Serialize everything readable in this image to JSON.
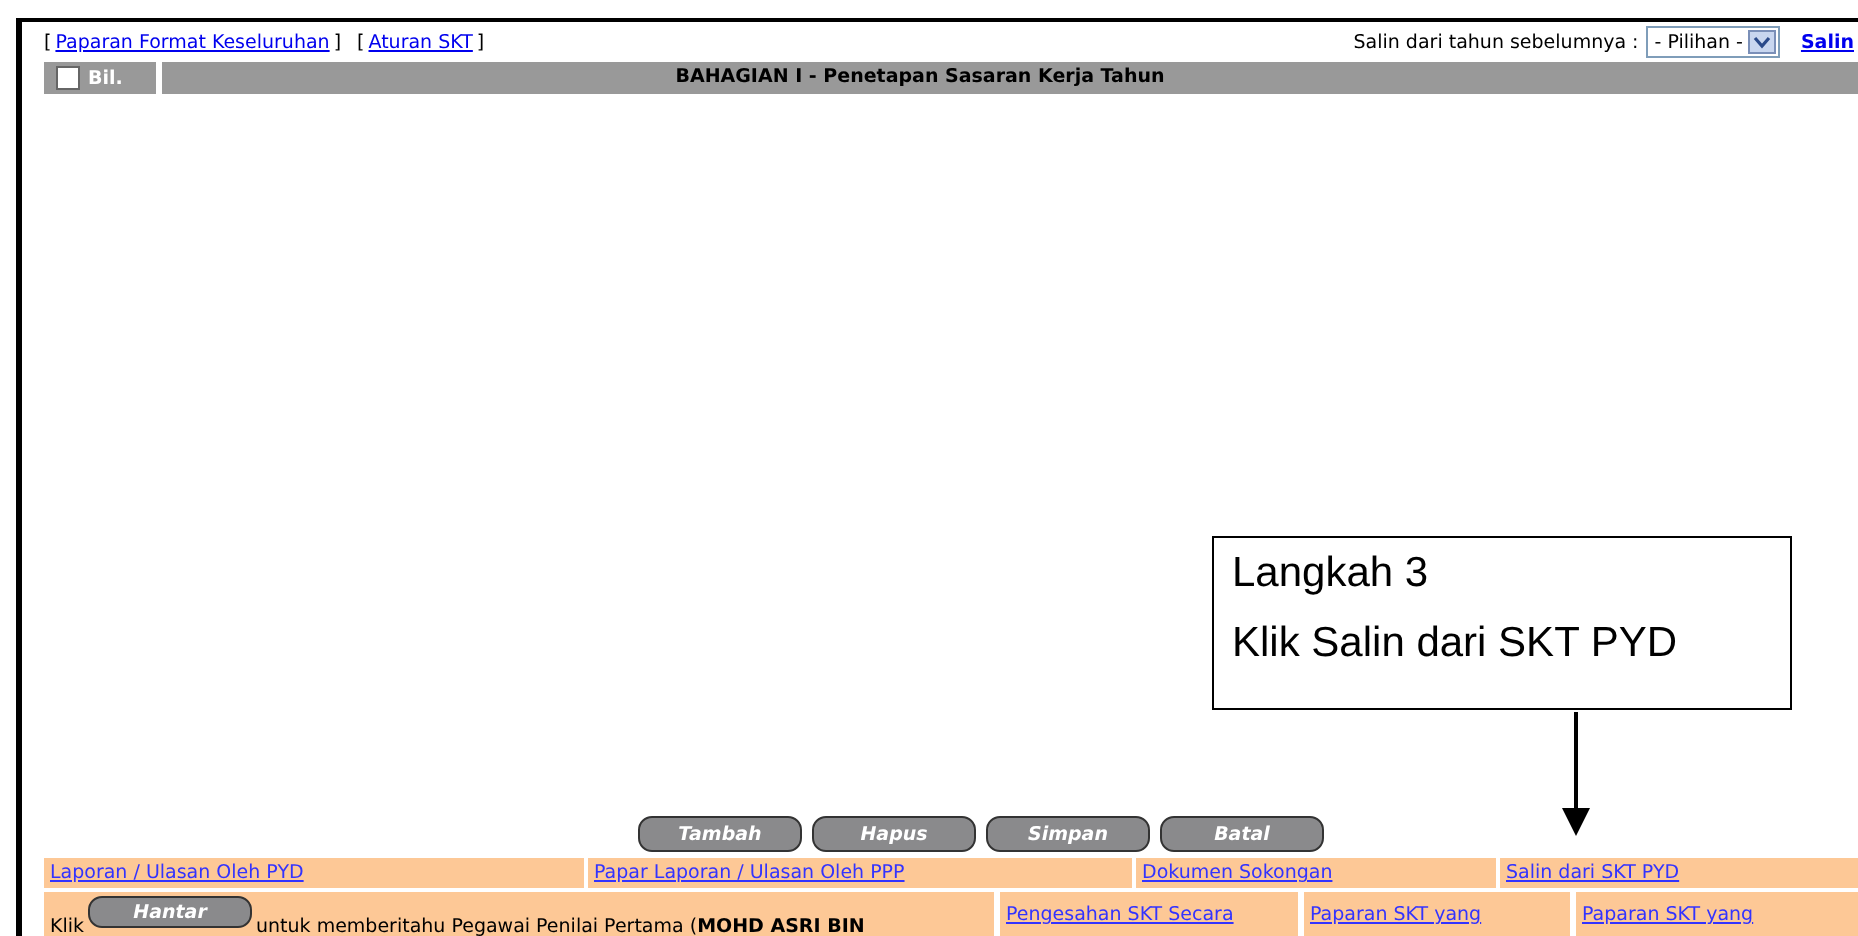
{
  "top_links": [
    {
      "open": "[",
      "label": "Paparan Format Keseluruhan",
      "close": "]"
    },
    {
      "open": "[",
      "label": "Aturan SKT",
      "close": "]"
    }
  ],
  "copy_from_year": {
    "label": "Salin dari tahun sebelumnya :",
    "select": "- Pilihan -",
    "action": "Salin"
  },
  "table": {
    "select_all_checked": false,
    "columns": [
      "Bil.",
      "BAHAGIAN I - Penetapan Sasaran Kerja Tahun"
    ]
  },
  "buttons": [
    "Tambah",
    "Hapus",
    "Simpan",
    "Batal"
  ],
  "links": [
    "Laporan / Ulasan Oleh PYD",
    "Papar Laporan / Ulasan Oleh PPP",
    "Dokumen Sokongan",
    "Salin dari SKT PYD"
  ],
  "submit_row": {
    "prefix": "Klik",
    "button": "Hantar",
    "text": "untuk memberitahu Pegawai Penilai Pertama (**MOHD ASRI BIN**",
    "links": [
      "Pengesahan SKT Secara",
      "Paparan SKT yang",
      "Paparan SKT yang"
    ]
  },
  "callout": {
    "lines": [
      "Langkah 3",
      "Klik Salin dari SKT PYD"
    ]
  }
}
